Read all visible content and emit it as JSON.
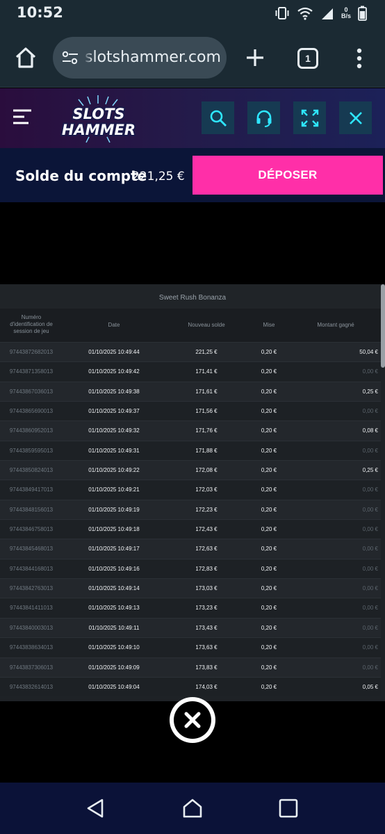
{
  "status_bar": {
    "time": "10:52",
    "net_speed_value": "0",
    "net_speed_unit": "B/s"
  },
  "browser": {
    "url": "slotshammer.com",
    "tab_count": "1"
  },
  "site": {
    "logo_line1": "SLOTS",
    "logo_line2": "HAMMER",
    "balance_label": "Solde du compte",
    "balance_value": "221,25 €",
    "deposit_label": "DÉPOSER",
    "accent_color": "#ff2fa8"
  },
  "history": {
    "title": "Sweet Rush Bonanza",
    "columns": {
      "id": "Numéro d'identification de session de jeu",
      "date": "Date",
      "solde": "Nouveau solde",
      "mise": "Mise",
      "gain": "Montant gagné"
    },
    "rows": [
      {
        "id": "97443872682013",
        "date": "01/10/2025 10:49:44",
        "solde": "221,25 €",
        "mise": "0,20 €",
        "gain": "50,04 €",
        "zero": false
      },
      {
        "id": "97443871358013",
        "date": "01/10/2025 10:49:42",
        "solde": "171,41 €",
        "mise": "0,20 €",
        "gain": "0,00 €",
        "zero": true
      },
      {
        "id": "97443867036013",
        "date": "01/10/2025 10:49:38",
        "solde": "171,61 €",
        "mise": "0,20 €",
        "gain": "0,25 €",
        "zero": false
      },
      {
        "id": "97443865690013",
        "date": "01/10/2025 10:49:37",
        "solde": "171,56 €",
        "mise": "0,20 €",
        "gain": "0,00 €",
        "zero": true
      },
      {
        "id": "97443860952013",
        "date": "01/10/2025 10:49:32",
        "solde": "171,76 €",
        "mise": "0,20 €",
        "gain": "0,08 €",
        "zero": false
      },
      {
        "id": "97443859595013",
        "date": "01/10/2025 10:49:31",
        "solde": "171,88 €",
        "mise": "0,20 €",
        "gain": "0,00 €",
        "zero": true
      },
      {
        "id": "97443850824013",
        "date": "01/10/2025 10:49:22",
        "solde": "172,08 €",
        "mise": "0,20 €",
        "gain": "0,25 €",
        "zero": false
      },
      {
        "id": "97443849417013",
        "date": "01/10/2025 10:49:21",
        "solde": "172,03 €",
        "mise": "0,20 €",
        "gain": "0,00 €",
        "zero": true
      },
      {
        "id": "97443848156013",
        "date": "01/10/2025 10:49:19",
        "solde": "172,23 €",
        "mise": "0,20 €",
        "gain": "0,00 €",
        "zero": true
      },
      {
        "id": "97443846758013",
        "date": "01/10/2025 10:49:18",
        "solde": "172,43 €",
        "mise": "0,20 €",
        "gain": "0,00 €",
        "zero": true
      },
      {
        "id": "97443845468013",
        "date": "01/10/2025 10:49:17",
        "solde": "172,63 €",
        "mise": "0,20 €",
        "gain": "0,00 €",
        "zero": true
      },
      {
        "id": "97443844168013",
        "date": "01/10/2025 10:49:16",
        "solde": "172,83 €",
        "mise": "0,20 €",
        "gain": "0,00 €",
        "zero": true
      },
      {
        "id": "97443842763013",
        "date": "01/10/2025 10:49:14",
        "solde": "173,03 €",
        "mise": "0,20 €",
        "gain": "0,00 €",
        "zero": true
      },
      {
        "id": "97443841411013",
        "date": "01/10/2025 10:49:13",
        "solde": "173,23 €",
        "mise": "0,20 €",
        "gain": "0,00 €",
        "zero": true
      },
      {
        "id": "97443840003013",
        "date": "01/10/2025 10:49:11",
        "solde": "173,43 €",
        "mise": "0,20 €",
        "gain": "0,00 €",
        "zero": true
      },
      {
        "id": "97443838634013",
        "date": "01/10/2025 10:49:10",
        "solde": "173,63 €",
        "mise": "0,20 €",
        "gain": "0,00 €",
        "zero": true
      },
      {
        "id": "97443837306013",
        "date": "01/10/2025 10:49:09",
        "solde": "173,83 €",
        "mise": "0,20 €",
        "gain": "0,00 €",
        "zero": true
      },
      {
        "id": "97443832614013",
        "date": "01/10/2025 10:49:04",
        "solde": "174,03 €",
        "mise": "0,20 €",
        "gain": "0,05 €",
        "zero": false
      }
    ]
  }
}
